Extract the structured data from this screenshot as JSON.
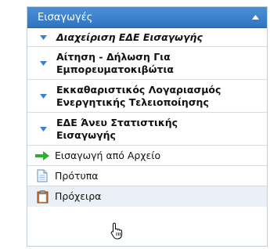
{
  "panel": {
    "title": "Εισαγωγές",
    "items": [
      {
        "label": "Διαχείριση ΕΔΕ Εισαγωγής",
        "icon": "blue-triangle-bullet"
      },
      {
        "label": "Αίτηση - Δήλωση Για Εμπορευματοκιβώτια",
        "icon": "blue-triangle-bullet"
      },
      {
        "label": "Εκκαθαριστικός Λογαριασμός Ενεργητικής Τελειοποίησης",
        "icon": "blue-triangle-bullet"
      },
      {
        "label": "ΕΔΕ Άνευ Στατιστικής Εισαγωγής",
        "icon": "blue-triangle-bullet"
      },
      {
        "label": "Εισαγωγή από Αρχείο",
        "icon": "green-arrow-icon"
      },
      {
        "label": "Πρότυπα",
        "icon": "document-icon"
      },
      {
        "label": "Πρόχειρα",
        "icon": "clipboard-icon"
      }
    ]
  },
  "colors": {
    "header_background": "#3a80cc",
    "bullet": "#3a7fd0",
    "arrow": "#2db12d"
  }
}
